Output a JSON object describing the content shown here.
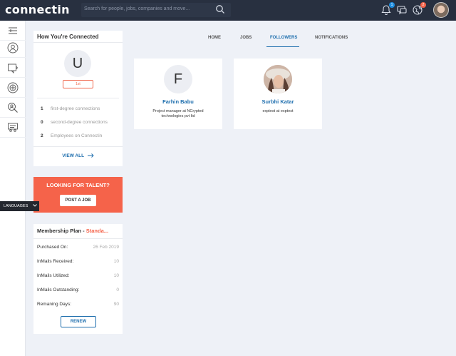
{
  "header": {
    "logo": "connectin",
    "search_placeholder": "Search for people, jobs, companies and move...",
    "notifications_badge": "1",
    "alerts_badge": "2",
    "colors": {
      "topbar": "#283040",
      "accent": "#1f6fae",
      "brand": "#f5634a"
    }
  },
  "sidebar": {
    "icons": [
      "menu-icon",
      "profile-icon",
      "contacts-icon",
      "network-icon",
      "search-people-icon",
      "groups-icon"
    ]
  },
  "connections": {
    "title": "How You're Connected",
    "avatar_letter": "U",
    "degree": "1st",
    "stats": [
      {
        "count": "1",
        "label": "first-degree connections"
      },
      {
        "count": "0",
        "label": "second-degree connections"
      },
      {
        "count": "2",
        "label": "Employees on Connectin"
      }
    ],
    "view_all": "VIEW ALL"
  },
  "talent": {
    "title": "LOOKING FOR TALENT?",
    "button": "POST A JOB"
  },
  "languages": "LANGUAGES",
  "membership": {
    "title_prefix": "Membership Plan - ",
    "plan": "Standa...",
    "rows": [
      {
        "label": "Purchased On:",
        "value": "26 Feb 2019"
      },
      {
        "label": "InMails Received:",
        "value": "10"
      },
      {
        "label": "InMails Utilized:",
        "value": "10"
      },
      {
        "label": "InMails Outstanding:",
        "value": "0"
      },
      {
        "label": "Remaning Days:",
        "value": "90"
      }
    ],
    "renew": "RENEW"
  },
  "tabs": [
    {
      "label": "HOME"
    },
    {
      "label": "JOBS"
    },
    {
      "label": "FOLLOWERS",
      "active": true
    },
    {
      "label": "NOTIFICATIONS"
    }
  ],
  "followers": [
    {
      "initial": "F",
      "name": "Farhin Babu",
      "desc": "Project manager at NCrypted technologies pvt ltd"
    },
    {
      "initial": "",
      "name": "Surbhi Katar",
      "desc": "exptest at exptest"
    }
  ]
}
